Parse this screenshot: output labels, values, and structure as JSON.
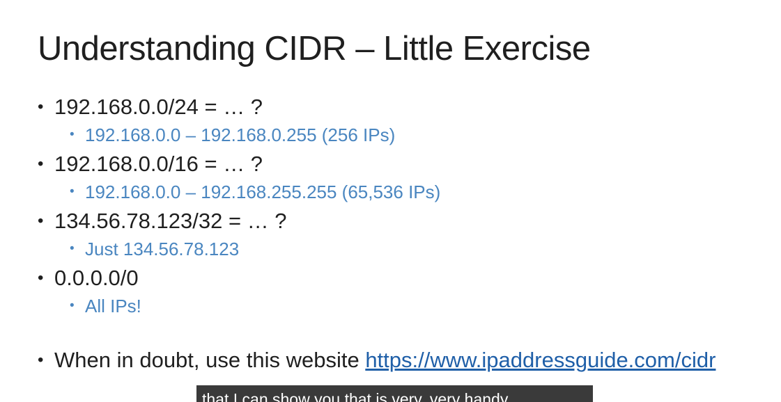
{
  "slide": {
    "title": "Understanding CIDR – Little Exercise",
    "bullet_char": "•",
    "items": [
      {
        "text": "192.168.0.0/24 = … ?",
        "answer": "192.168.0.0 – 192.168.0.255 (256 IPs)"
      },
      {
        "text": "192.168.0.0/16 = … ?",
        "answer": "192.168.0.0 – 192.168.255.255 (65,536 IPs)"
      },
      {
        "text": "134.56.78.123/32 = … ?",
        "answer": "Just 134.56.78.123"
      },
      {
        "text": "0.0.0.0/0",
        "answer": "All IPs!"
      }
    ],
    "tip": {
      "prefix": "When in doubt, use this website ",
      "link_text": "https://www.ipaddressguide.com/cidr"
    }
  },
  "caption": {
    "text": "that I can show you that is very, very handy."
  },
  "colors": {
    "text": "#1f1f1f",
    "sub_bullet": "#4a86c0",
    "link": "#1f5fa8",
    "caption_bg": "#3a3a3a"
  }
}
